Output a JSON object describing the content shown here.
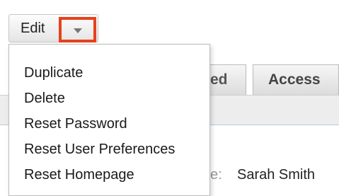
{
  "toolbar": {
    "edit_label": "Edit",
    "dropdown_icon": "caret-down-icon",
    "highlight_color": "#e8401c"
  },
  "menu": {
    "items": [
      {
        "label": "Duplicate"
      },
      {
        "label": "Delete"
      },
      {
        "label": "Reset Password"
      },
      {
        "label": "Reset User Preferences"
      },
      {
        "label": "Reset Homepage"
      }
    ]
  },
  "tabs": [
    {
      "label": "ed"
    },
    {
      "label": "Access"
    }
  ],
  "record": {
    "field_label_fragment": "e:",
    "full_name": "Sarah Smith"
  }
}
